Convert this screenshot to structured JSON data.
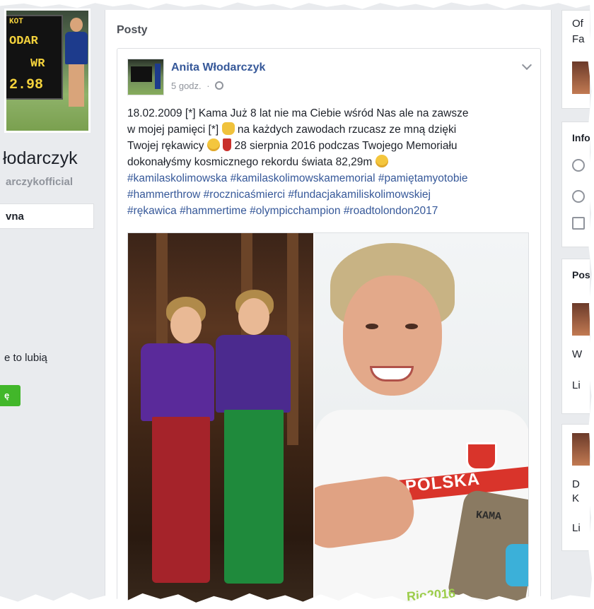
{
  "left_column": {
    "profile_name": "łodarczyk",
    "profile_handle": "arczykofficial",
    "nav_active": "vna",
    "likes_text": "e to lubią",
    "like_button": "ę",
    "scoreboard": {
      "line1": "KOT",
      "line2": "ODAR",
      "line3": "WR",
      "line4": "2.98"
    }
  },
  "main": {
    "section_title": "Posty",
    "post": {
      "author": "Anita Włodarczyk",
      "time": "5 godz.",
      "separator": "·",
      "text_line1": "18.02.2009 [*] Kama Już 8 lat nie ma Ciebie wśród Nas ale na zawsze",
      "text_line2a": "w mojej pamięci [*]",
      "text_line2b": "na każdych zawodach rzucasz ze mną dzięki",
      "text_line3a": "Twojej rękawicy",
      "text_line3b": "28 sierpnia 2016 podczas Twojego Memoriału",
      "text_line4": "dokonałyśmy kosmicznego rekordu świata 82,29m",
      "hashtags_line1": "#kamilaskolimowska #kamilaskolimowskamemorial #pamiętamyotobie",
      "hashtags_line2": "#hammerthrow #rocznicaśmierci #fundacjakamiliskolimowskiej",
      "hashtags_line3": "#rękawica #hammertime #olympicchampion #roadtolondon2017",
      "photo_jersey_text": "POLSKA",
      "photo_glove_text": "KAMA",
      "photo_rio_text": "Rio2016"
    }
  },
  "right_column": {
    "box1_text_a": "Of",
    "box1_text_b": "Fa",
    "box2_title": "Info",
    "box3_title": "Pos",
    "box3_text_a": "W",
    "box3_text_b": "Li",
    "box4_text_a": "D",
    "box4_text_b": "K",
    "box4_text_c": "Li"
  }
}
